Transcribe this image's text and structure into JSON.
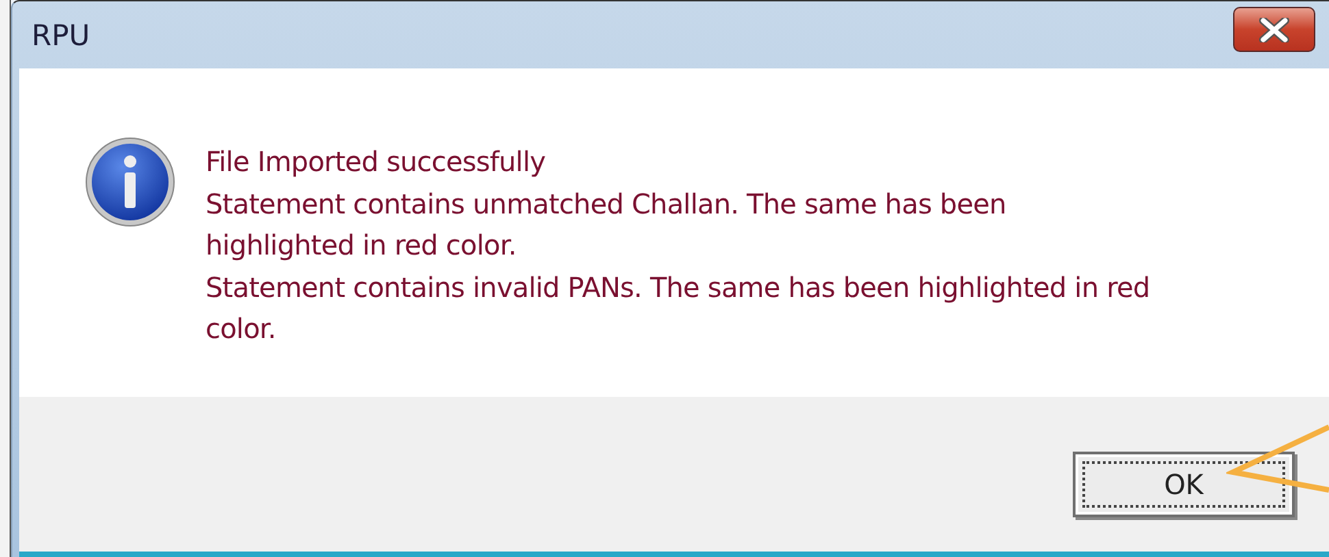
{
  "window": {
    "title": "RPU"
  },
  "message_lines": [
    "File Imported successfully",
    "Statement contains unmatched Challan. The same has been",
    "highlighted in red color.",
    "Statement contains invalid PANs. The same has been highlighted in red",
    "color."
  ],
  "buttons": [
    {
      "label": "OK",
      "focused": true
    }
  ]
}
